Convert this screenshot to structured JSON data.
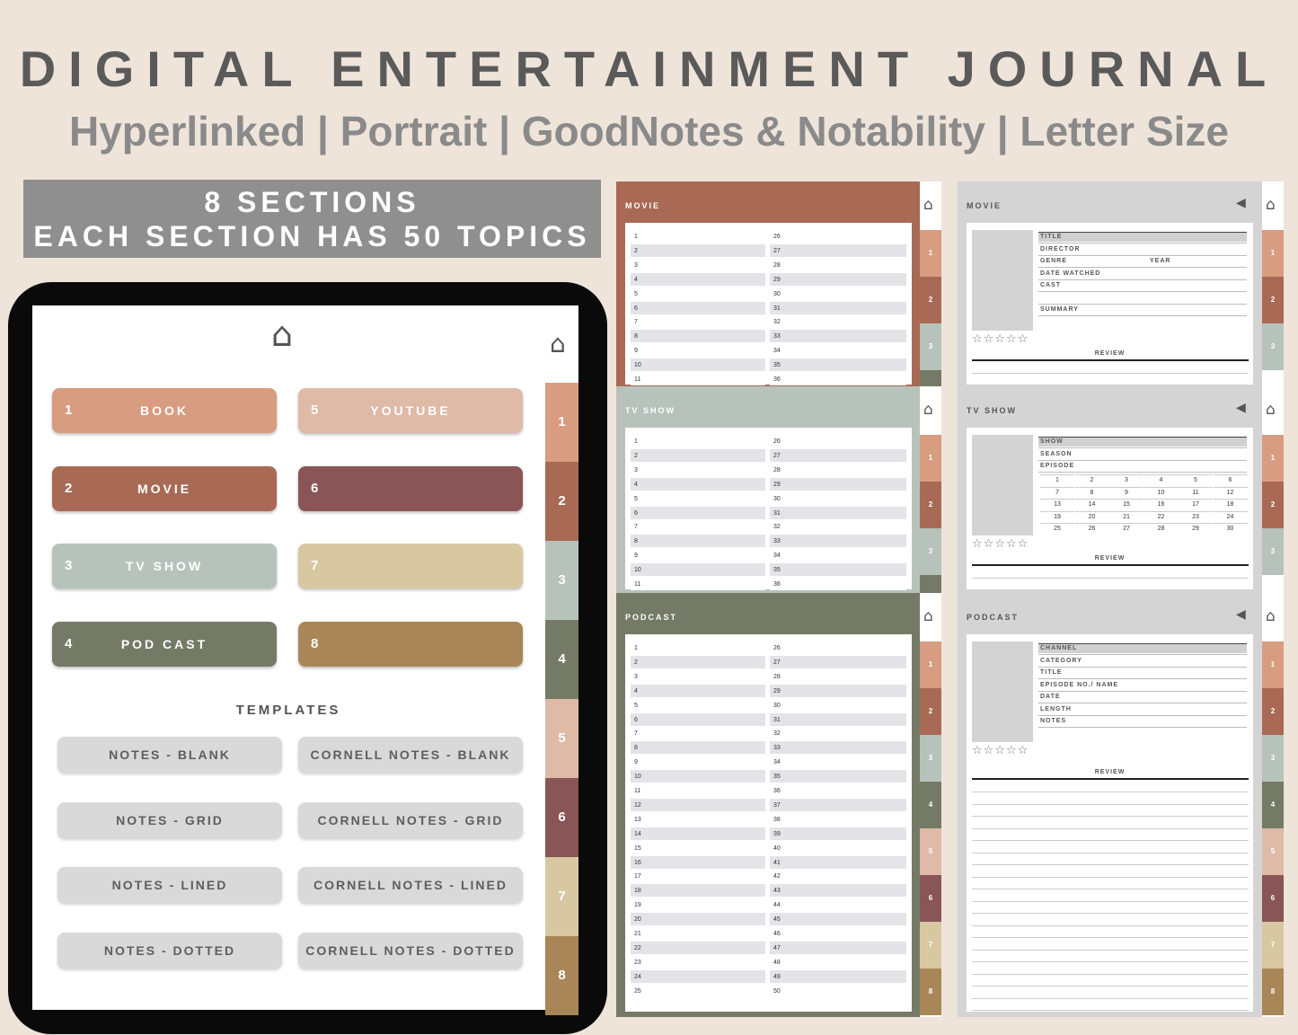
{
  "header": {
    "title": "DIGITAL ENTERTAINMENT JOURNAL",
    "subtitle": "Hyperlinked | Portrait | GoodNotes & Notability | Letter Size"
  },
  "banner": {
    "line1": "8 SECTIONS",
    "line2": "EACH SECTION HAS 50 TOPICS"
  },
  "colors": {
    "s1": "#d89c80",
    "s2": "#a86a55",
    "s3": "#b7c3ba",
    "s4": "#747a66",
    "s5": "#debaa7",
    "s6": "#8a5556",
    "s7": "#d8c8a2",
    "s8": "#a98658"
  },
  "tablet": {
    "home_icon": "home-icon",
    "sections": [
      {
        "num": "1",
        "label": "BOOK"
      },
      {
        "num": "2",
        "label": "MOVIE"
      },
      {
        "num": "3",
        "label": "TV SHOW"
      },
      {
        "num": "4",
        "label": "POD CAST"
      },
      {
        "num": "5",
        "label": "YOUTUBE"
      },
      {
        "num": "6",
        "label": ""
      },
      {
        "num": "7",
        "label": ""
      },
      {
        "num": "8",
        "label": ""
      }
    ],
    "templates_heading": "TEMPLATES",
    "templates": [
      "NOTES - BLANK",
      "CORNELL NOTES - BLANK",
      "NOTES - GRID",
      "CORNELL NOTES - GRID",
      "NOTES - LINED",
      "CORNELL NOTES - LINED",
      "NOTES - DOTTED",
      "CORNELL NOTES - DOTTED"
    ],
    "side_tabs": [
      "1",
      "2",
      "3",
      "4",
      "5",
      "6",
      "7",
      "8"
    ]
  },
  "pages": {
    "movie_list": {
      "title": "MOVIE"
    },
    "tv_list": {
      "title": "TV SHOW"
    },
    "podcast_list": {
      "title": "PODCAST"
    },
    "movie_detail": {
      "title": "MOVIE",
      "fields": [
        "TITLE",
        "DIRECTOR",
        "GENRE",
        "DATE WATCHED",
        "CAST",
        "",
        "SUMMARY"
      ],
      "year_label": "YEAR",
      "stars": "☆☆☆☆☆",
      "review_label": "REVIEW"
    },
    "tv_detail": {
      "title": "TV SHOW",
      "fields": [
        "SHOW",
        "SEASON",
        "EPISODE"
      ],
      "episodes": [
        "1",
        "2",
        "3",
        "4",
        "5",
        "6",
        "7",
        "8",
        "9",
        "10",
        "11",
        "12",
        "13",
        "14",
        "15",
        "16",
        "17",
        "18",
        "19",
        "20",
        "21",
        "22",
        "23",
        "24",
        "25",
        "26",
        "27",
        "28",
        "29",
        "30"
      ],
      "stars": "☆☆☆☆☆",
      "review_label": "REVIEW"
    },
    "podcast_detail": {
      "title": "PODCAST",
      "fields": [
        "CHANNEL",
        "CATEGORY",
        "TITLE",
        "EPISODE NO./ NAME",
        "DATE",
        "LENGTH",
        "NOTES"
      ],
      "stars": "☆☆☆☆☆",
      "review_label": "REVIEW"
    },
    "list_numbers_left": [
      "1",
      "2",
      "3",
      "4",
      "5",
      "6",
      "7",
      "8",
      "9",
      "10",
      "11",
      "12",
      "13",
      "14",
      "15",
      "16",
      "17",
      "18",
      "19",
      "20",
      "21",
      "22",
      "23",
      "24",
      "25"
    ],
    "list_numbers_right": [
      "26",
      "27",
      "28",
      "29",
      "30",
      "31",
      "32",
      "33",
      "34",
      "35",
      "36",
      "37",
      "38",
      "39",
      "40",
      "41",
      "42",
      "43",
      "44",
      "45",
      "46",
      "47",
      "48",
      "49",
      "50"
    ],
    "tab_numbers": [
      "1",
      "2",
      "3",
      "4",
      "5",
      "6",
      "7",
      "8"
    ]
  }
}
